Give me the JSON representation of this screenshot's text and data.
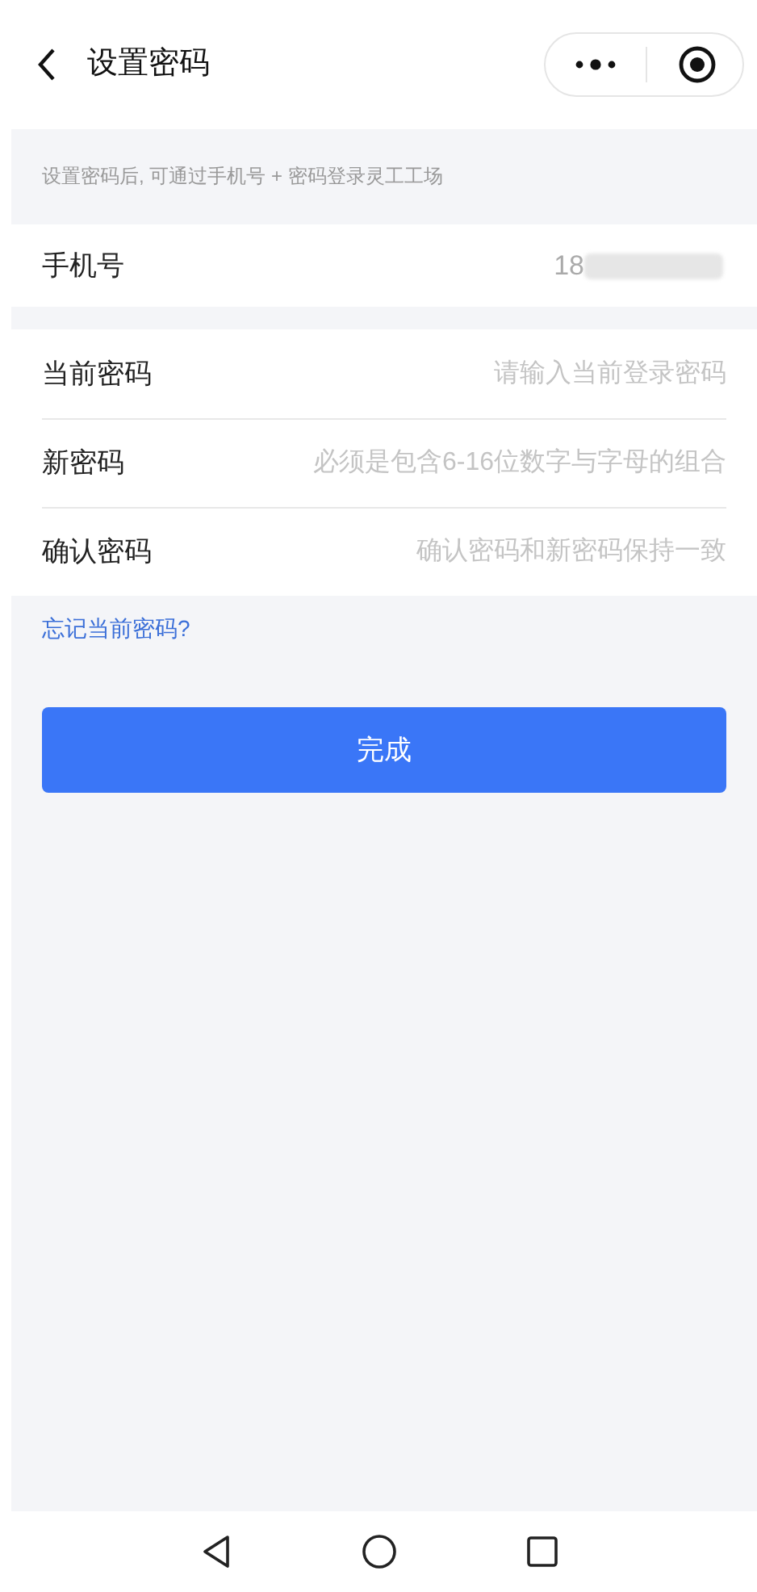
{
  "header": {
    "title": "设置密码"
  },
  "notice": "设置密码后, 可通过手机号 + 密码登录灵工工场",
  "phone": {
    "label": "手机号",
    "value": "18"
  },
  "fields": [
    {
      "label": "当前密码",
      "placeholder": "请输入当前登录密码"
    },
    {
      "label": "新密码",
      "placeholder": "必须是包含6-16位数字与字母的组合"
    },
    {
      "label": "确认密码",
      "placeholder": "确认密码和新密码保持一致"
    }
  ],
  "forgot_link": "忘记当前密码?",
  "submit_button": "完成"
}
